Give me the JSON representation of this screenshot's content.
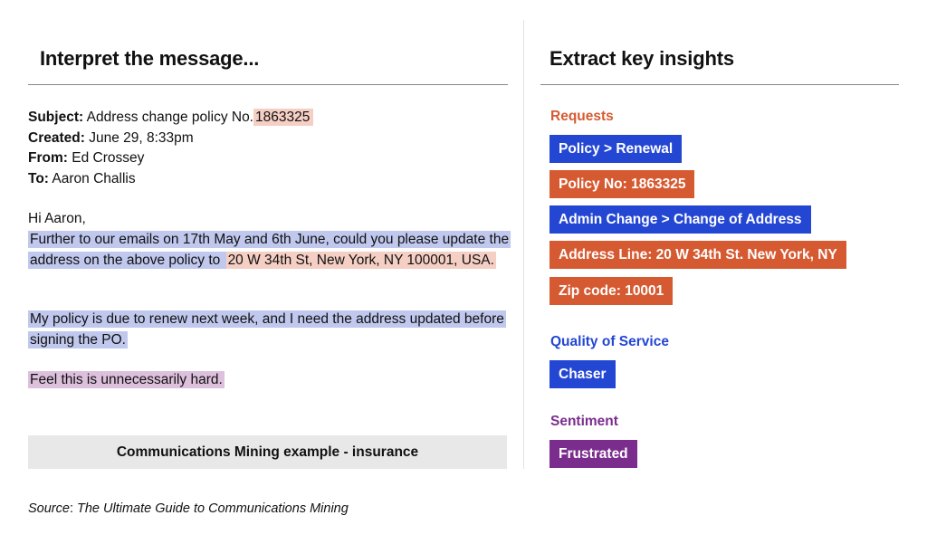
{
  "left_panel": {
    "title": "Interpret the message...",
    "meta": {
      "subject_label": "Subject:",
      "subject_text": "Address change policy No.",
      "subject_highlight": "1863325",
      "created_label": "Created:",
      "created_value": "June 29, 8:33pm",
      "from_label": "From:",
      "from_value": "Ed Crossey",
      "to_label": "To:",
      "to_value": "Aaron Challis"
    },
    "greeting": "Hi Aaron,",
    "paragraph1_request": "Further to our emails on 17th May and 6th June, could you please update the address on the above policy to",
    "paragraph1_address": "20 W 34th St, New York, NY 100001, USA.",
    "paragraph2": "My policy is due to renew next week, and I need the address updated before signing the PO.",
    "paragraph3": "Feel this is unnecessarily hard.",
    "caption": "Communications Mining example - insurance"
  },
  "source": {
    "label": "Source",
    "separator": ": ",
    "title": "The Ultimate Guide to Communications Mining"
  },
  "right_panel": {
    "title": "Extract key insights",
    "sections": [
      {
        "label": "Requests",
        "color": "#d65a31",
        "tags": [
          {
            "text": "Policy > Renewal",
            "color": "#2346d3"
          },
          {
            "text": "Policy No: 1863325",
            "color": "#d65a31"
          },
          {
            "text": "Admin Change > Change of Address",
            "color": "#2346d3"
          },
          {
            "text": "Address Line: 20 W 34th St. New York, NY",
            "color": "#d65a31"
          },
          {
            "text": "Zip code: 10001",
            "color": "#d65a31"
          }
        ]
      },
      {
        "label": "Quality of Service",
        "color": "#2346d3",
        "tags": [
          {
            "text": "Chaser",
            "color": "#2346d3"
          }
        ]
      },
      {
        "label": "Sentiment",
        "color": "#7b2d8e",
        "tags": [
          {
            "text": "Frustrated",
            "color": "#7b2d8e"
          }
        ]
      }
    ]
  },
  "highlight_colors": {
    "entity": "#f5cfc4",
    "request": "#c0c8ee",
    "sentiment": "#dcc0dc"
  }
}
